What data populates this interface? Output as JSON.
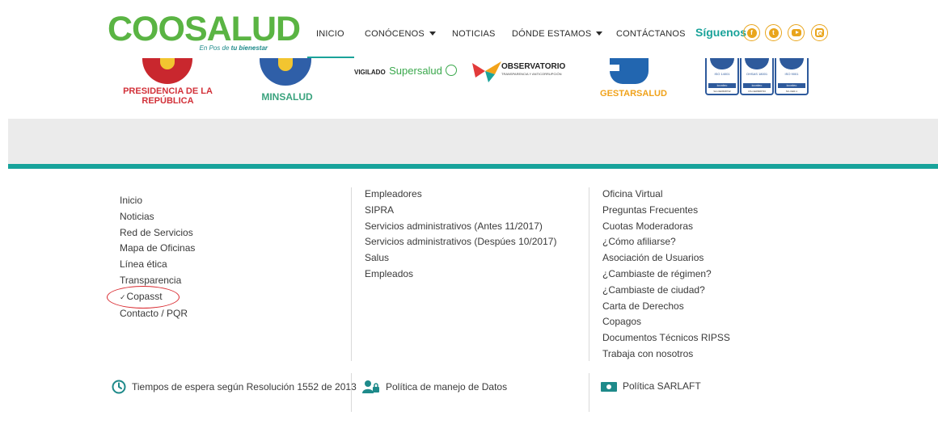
{
  "brand": {
    "logo_text": "COOSALUD",
    "tagline_prefix": "En Pos de ",
    "tagline_bold": "tu bienestar",
    "accent": "#1aa39a",
    "logo_green": "#5ab443",
    "social_color": "#e9a51c"
  },
  "nav": {
    "items": [
      {
        "label": "INICIO",
        "has_dropdown": false,
        "active": true
      },
      {
        "label": "CONÓCENOS",
        "has_dropdown": true
      },
      {
        "label": "NOTICIAS",
        "has_dropdown": false
      },
      {
        "label": "DÓNDE ESTAMOS",
        "has_dropdown": true
      },
      {
        "label": "CONTÁCTANOS",
        "has_dropdown": false
      }
    ],
    "follow_label": "Síguenos",
    "social": [
      "facebook-icon",
      "twitter-icon",
      "youtube-icon",
      "instagram-icon"
    ]
  },
  "institutions": {
    "presidencia": "PRESIDENCIA DE LA REPÚBLICA",
    "minsalud": "MINSALUD",
    "vigilado_prefix": "VIGILADO",
    "supersalud": "Supersalud",
    "observatorio": "OBSERVATORIO",
    "observatorio_sub": "TRANSPARENCIA Y ANTICORRUPCIÓN",
    "gestarsalud": "GESTARSALUD",
    "certs": [
      {
        "code": "ISO 14001",
        "brand": "icontec",
        "id": "SA-CER608732"
      },
      {
        "code": "OHSAS 18001",
        "brand": "icontec",
        "id": "OS-CER608733"
      },
      {
        "code": "ISO 9001",
        "brand": "icontec",
        "id": "SC-CER-1"
      }
    ]
  },
  "footer": {
    "col1": [
      "Inicio",
      "Noticias",
      "Red de Servicios",
      "Mapa de Oficinas",
      "Línea ética",
      "Transparencia",
      "Copasst",
      "Contacto / PQR"
    ],
    "col2": [
      "Empleadores",
      "SIPRA",
      "Servicios administrativos (Antes 11/2017)",
      "Servicios administrativos (Despúes 10/2017)",
      "Salus",
      "Empleados"
    ],
    "col3": [
      "Oficina Virtual",
      "Preguntas Frecuentes",
      "Cuotas Moderadoras",
      "¿Cómo afiliarse?",
      "Asociación de Usuarios",
      "¿Cambiaste de régimen?",
      "¿Cambiaste de ciudad?",
      "Carta de Derechos",
      "Copagos",
      "Documentos Técnicos RIPSS",
      "Trabaja con nosotros"
    ],
    "bottom": {
      "tiempos": "Tiempos de espera según Resolución 1552 de 2013",
      "politica_datos": "Política de manejo de Datos",
      "sarlaft": "Política SARLAFT"
    },
    "highlight_color": "#d9292f"
  }
}
